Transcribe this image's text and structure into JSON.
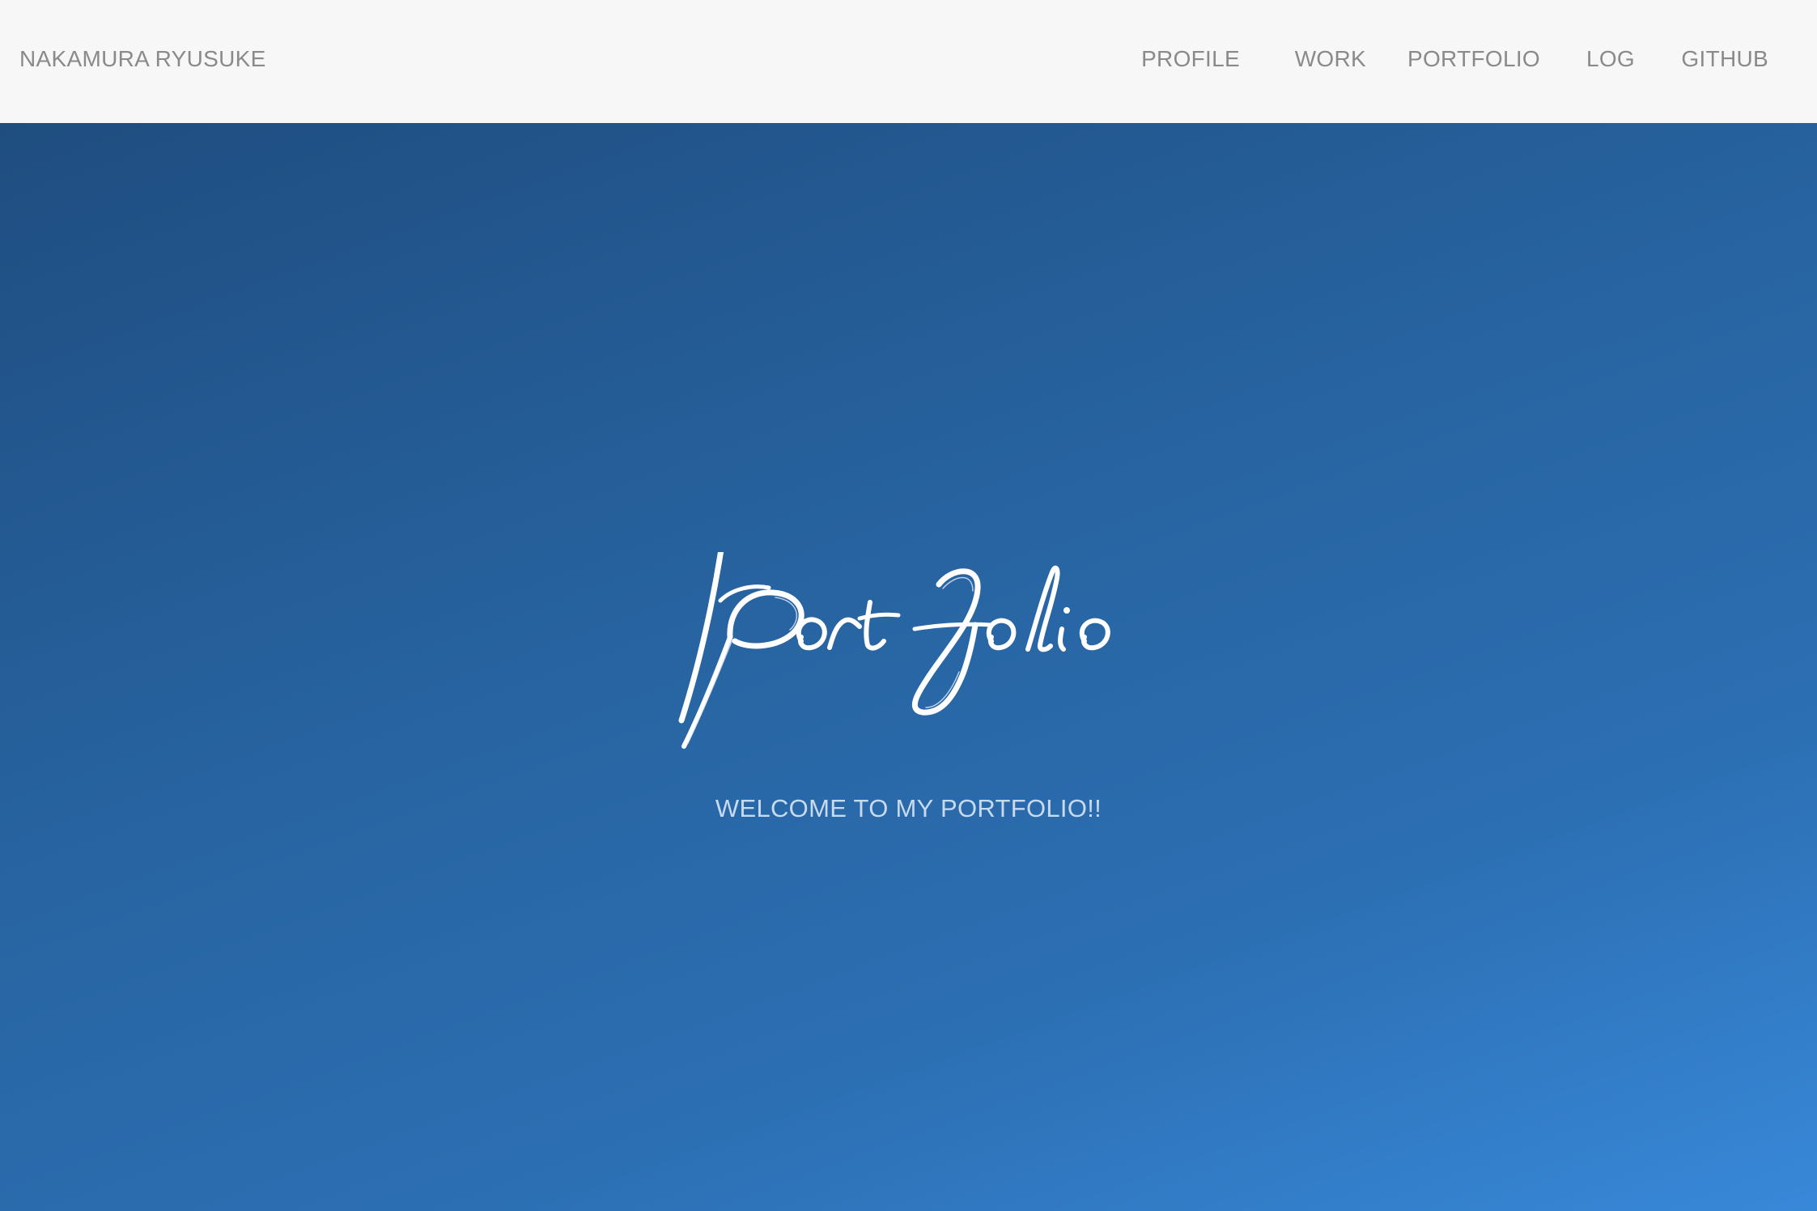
{
  "navbar": {
    "brand": "NAKAMURA RYUSUKE",
    "items": [
      {
        "label": "PROFILE"
      },
      {
        "label": "WORK"
      },
      {
        "label": "PORTFOLIO"
      },
      {
        "label": "LOG"
      },
      {
        "label": "GITHUB"
      }
    ]
  },
  "hero": {
    "logo_text": "Portfolio",
    "tagline": "WELCOME TO MY PORTFOLIO!!"
  },
  "colors": {
    "navbar_bg": "#f7f7f7",
    "nav_text": "#8a8a8a",
    "hero_gradient_start": "#1f4d80",
    "hero_gradient_end": "#3888d9",
    "tagline": "#c8daf0"
  }
}
